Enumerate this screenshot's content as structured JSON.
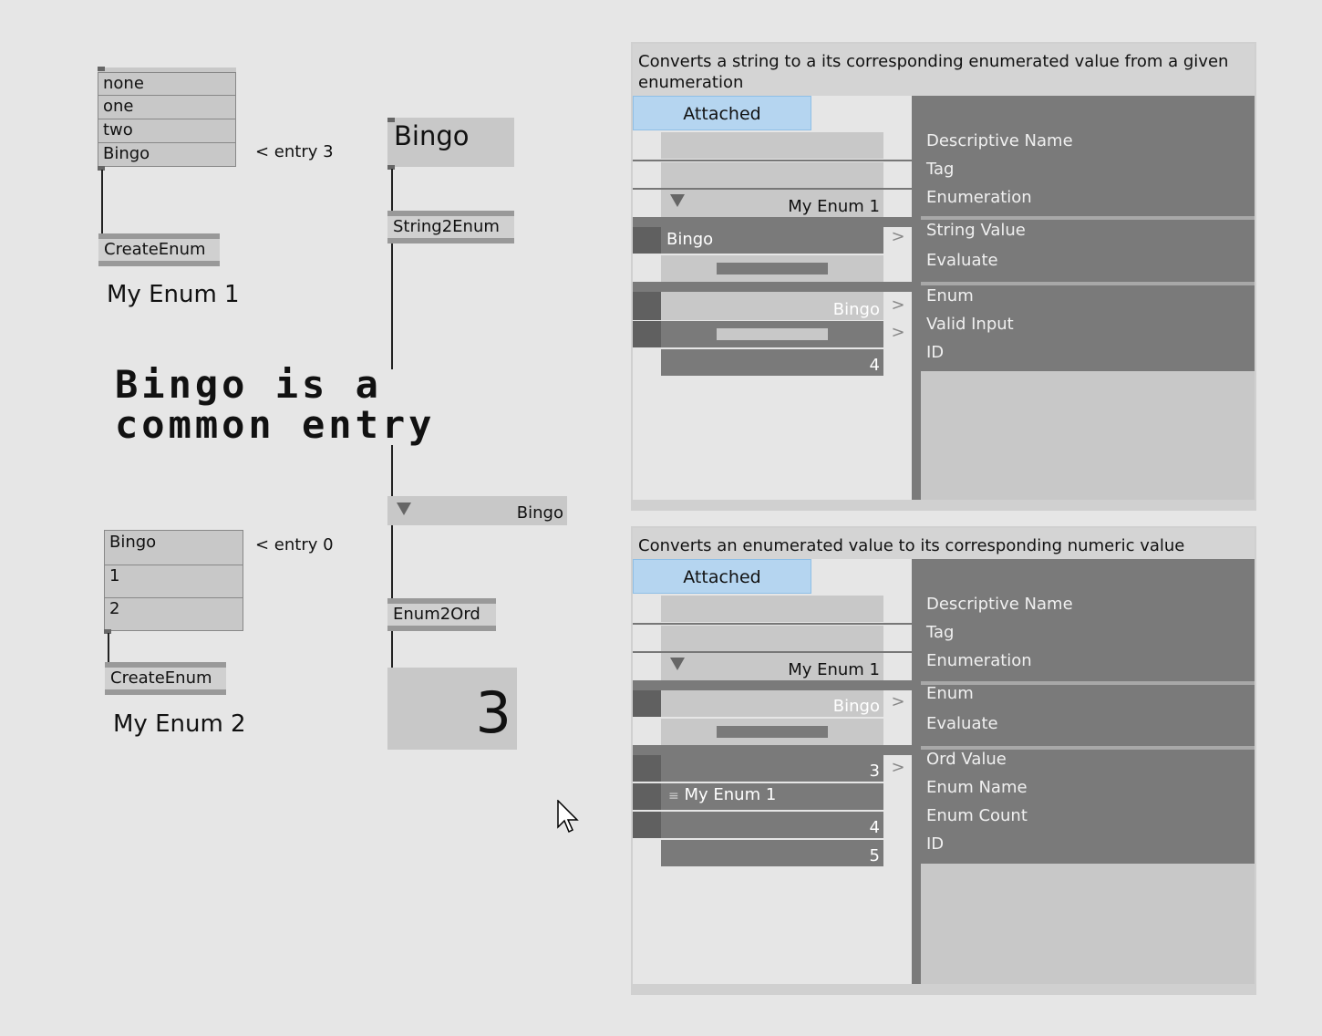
{
  "patch": {
    "enum1_entries": [
      "none",
      "one",
      "two",
      "Bingo"
    ],
    "enum1_comment": "< entry 3",
    "enum1_node": "CreateEnum",
    "enum1_label": "My Enum 1",
    "enum2_entries": [
      "Bingo",
      "1",
      "2"
    ],
    "enum2_comment": "< entry 0",
    "enum2_node": "CreateEnum",
    "enum2_label": "My Enum 2",
    "big_comment_line1": "Bingo is a",
    "big_comment_line2": "common entry",
    "string_input": "Bingo",
    "string2enum_node": "String2Enum",
    "enum_output": "Bingo",
    "enum2ord_node": "Enum2Ord",
    "ord_output": "3"
  },
  "inspector1": {
    "description": "Converts a string to a its corresponding enumerated value from a given enumeration",
    "attached": "Attached",
    "enumeration_value": "My Enum 1",
    "string_value": "Bingo",
    "enum_value": "Bingo",
    "id_value": "4",
    "pins": [
      [
        "Descriptive Name",
        "Tag",
        "Enumeration"
      ],
      [
        "String Value",
        "Evaluate"
      ],
      [
        "Enum",
        "Valid Input",
        "ID"
      ]
    ]
  },
  "inspector2": {
    "description": "Converts an enumerated value to its corresponding numeric value",
    "attached": "Attached",
    "enumeration_value": "My Enum 1",
    "enum_value": "Bingo",
    "ord_value": "3",
    "enum_name": "My Enum 1",
    "enum_count": "4",
    "id_value": "5",
    "pins": [
      [
        "Descriptive Name",
        "Tag",
        "Enumeration"
      ],
      [
        "Enum",
        "Evaluate"
      ],
      [
        "Ord Value",
        "Enum Name",
        "Enum Count",
        "ID"
      ]
    ]
  },
  "colors": {
    "attached": "#b5d5f0",
    "pin_dark": "#7a7a7a",
    "value_box": "#c8c8c8"
  }
}
